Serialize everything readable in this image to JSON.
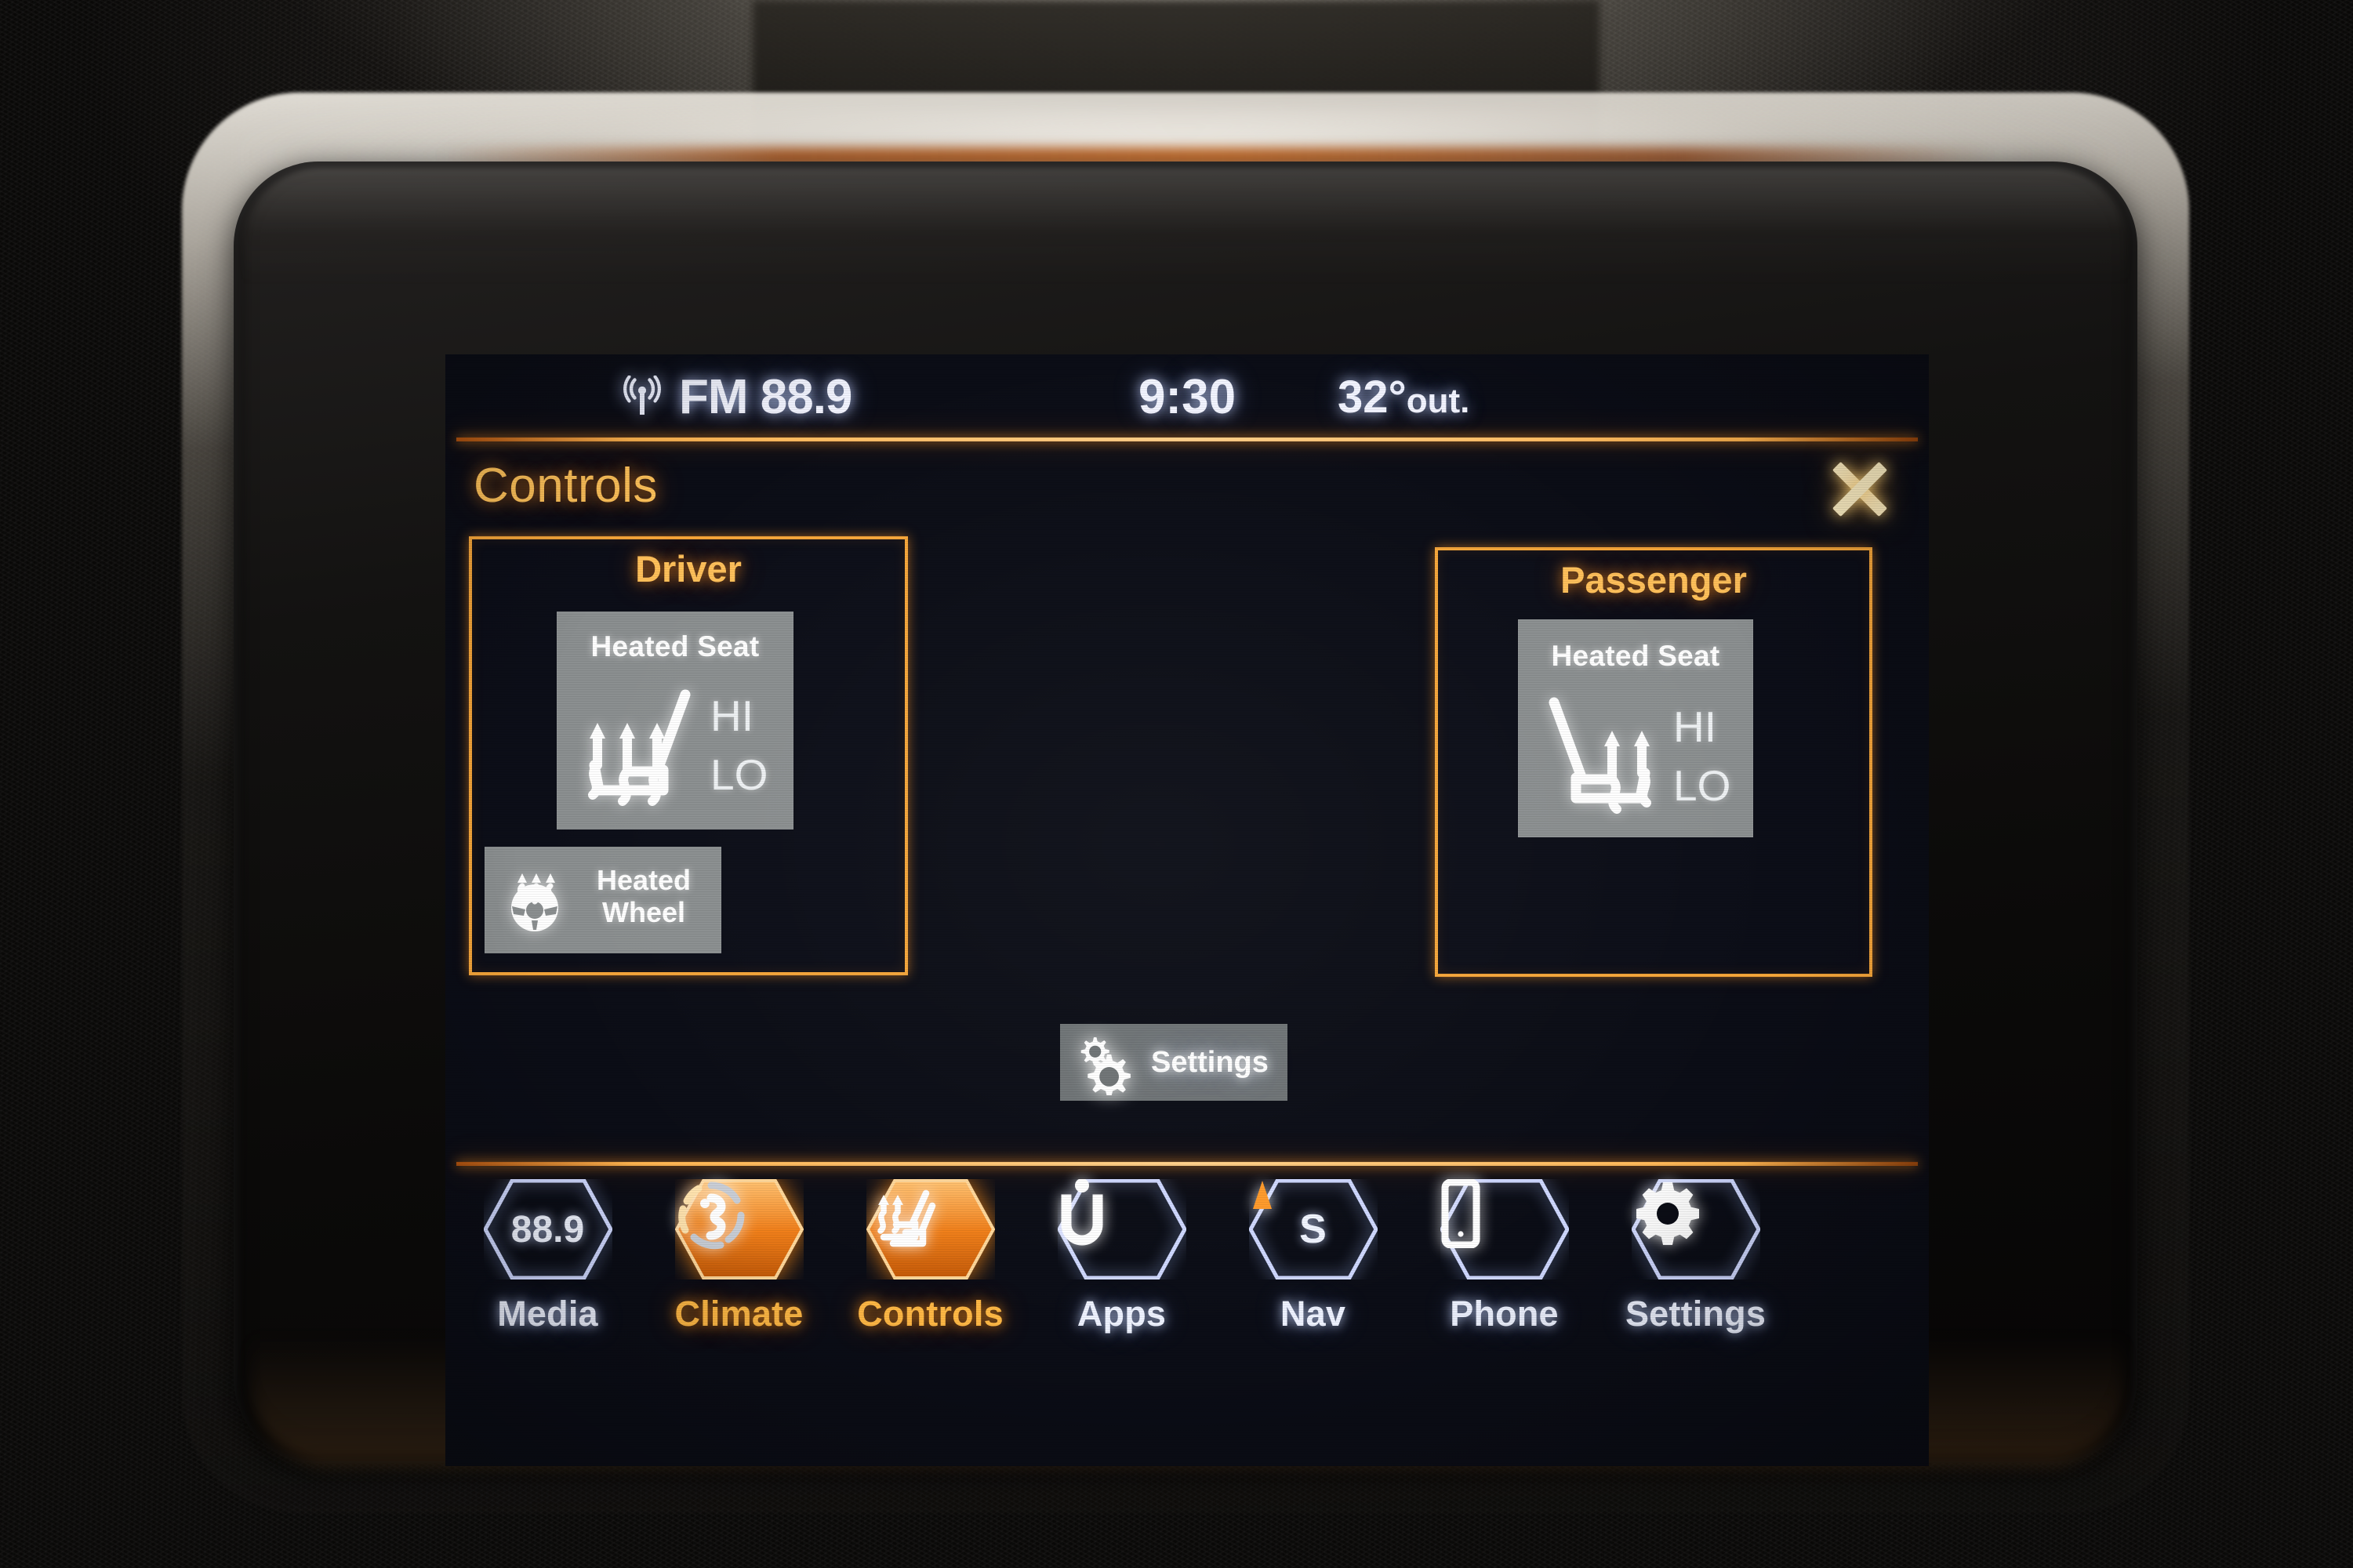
{
  "statusbar": {
    "radio_icon": "radio-tower-icon",
    "radio_band": "FM 88.9",
    "clock": "9:30",
    "temperature": "32°",
    "temperature_suffix": "out."
  },
  "header": {
    "title": "Controls",
    "close_icon": "close-icon"
  },
  "driver": {
    "title": "Driver",
    "heated_seat": {
      "label": "Heated Seat",
      "icon": "heated-seat-icon",
      "level_hi": "HI",
      "level_lo": "LO"
    },
    "heated_wheel": {
      "label_line1": "Heated",
      "label_line2": "Wheel",
      "icon": "heated-steering-wheel-icon"
    }
  },
  "passenger": {
    "title": "Passenger",
    "heated_seat": {
      "label": "Heated Seat",
      "icon": "heated-seat-icon",
      "level_hi": "HI",
      "level_lo": "LO"
    }
  },
  "settings_button": {
    "label": "Settings",
    "icon": "gears-icon"
  },
  "navbar": {
    "items": [
      {
        "label": "Media",
        "icon": "radio-frequency-icon",
        "badge": "88.9",
        "active": false
      },
      {
        "label": "Climate",
        "icon": "fan-icon",
        "active": true
      },
      {
        "label": "Controls",
        "icon": "heated-seats-icon",
        "active": true
      },
      {
        "label": "Apps",
        "icon": "uconnect-u-icon",
        "active": false
      },
      {
        "label": "Nav",
        "icon": "compass-icon",
        "badge": "S",
        "active": false
      },
      {
        "label": "Phone",
        "icon": "phone-icon",
        "active": false
      },
      {
        "label": "Settings",
        "icon": "gear-icon",
        "active": false
      }
    ]
  },
  "colors": {
    "accent_orange": "#f6a63a",
    "title_orange": "#ffc25a",
    "screen_bg": "#0b0d16",
    "tile_gray": "#8b8f90",
    "status_text": "#f2f4ff"
  }
}
